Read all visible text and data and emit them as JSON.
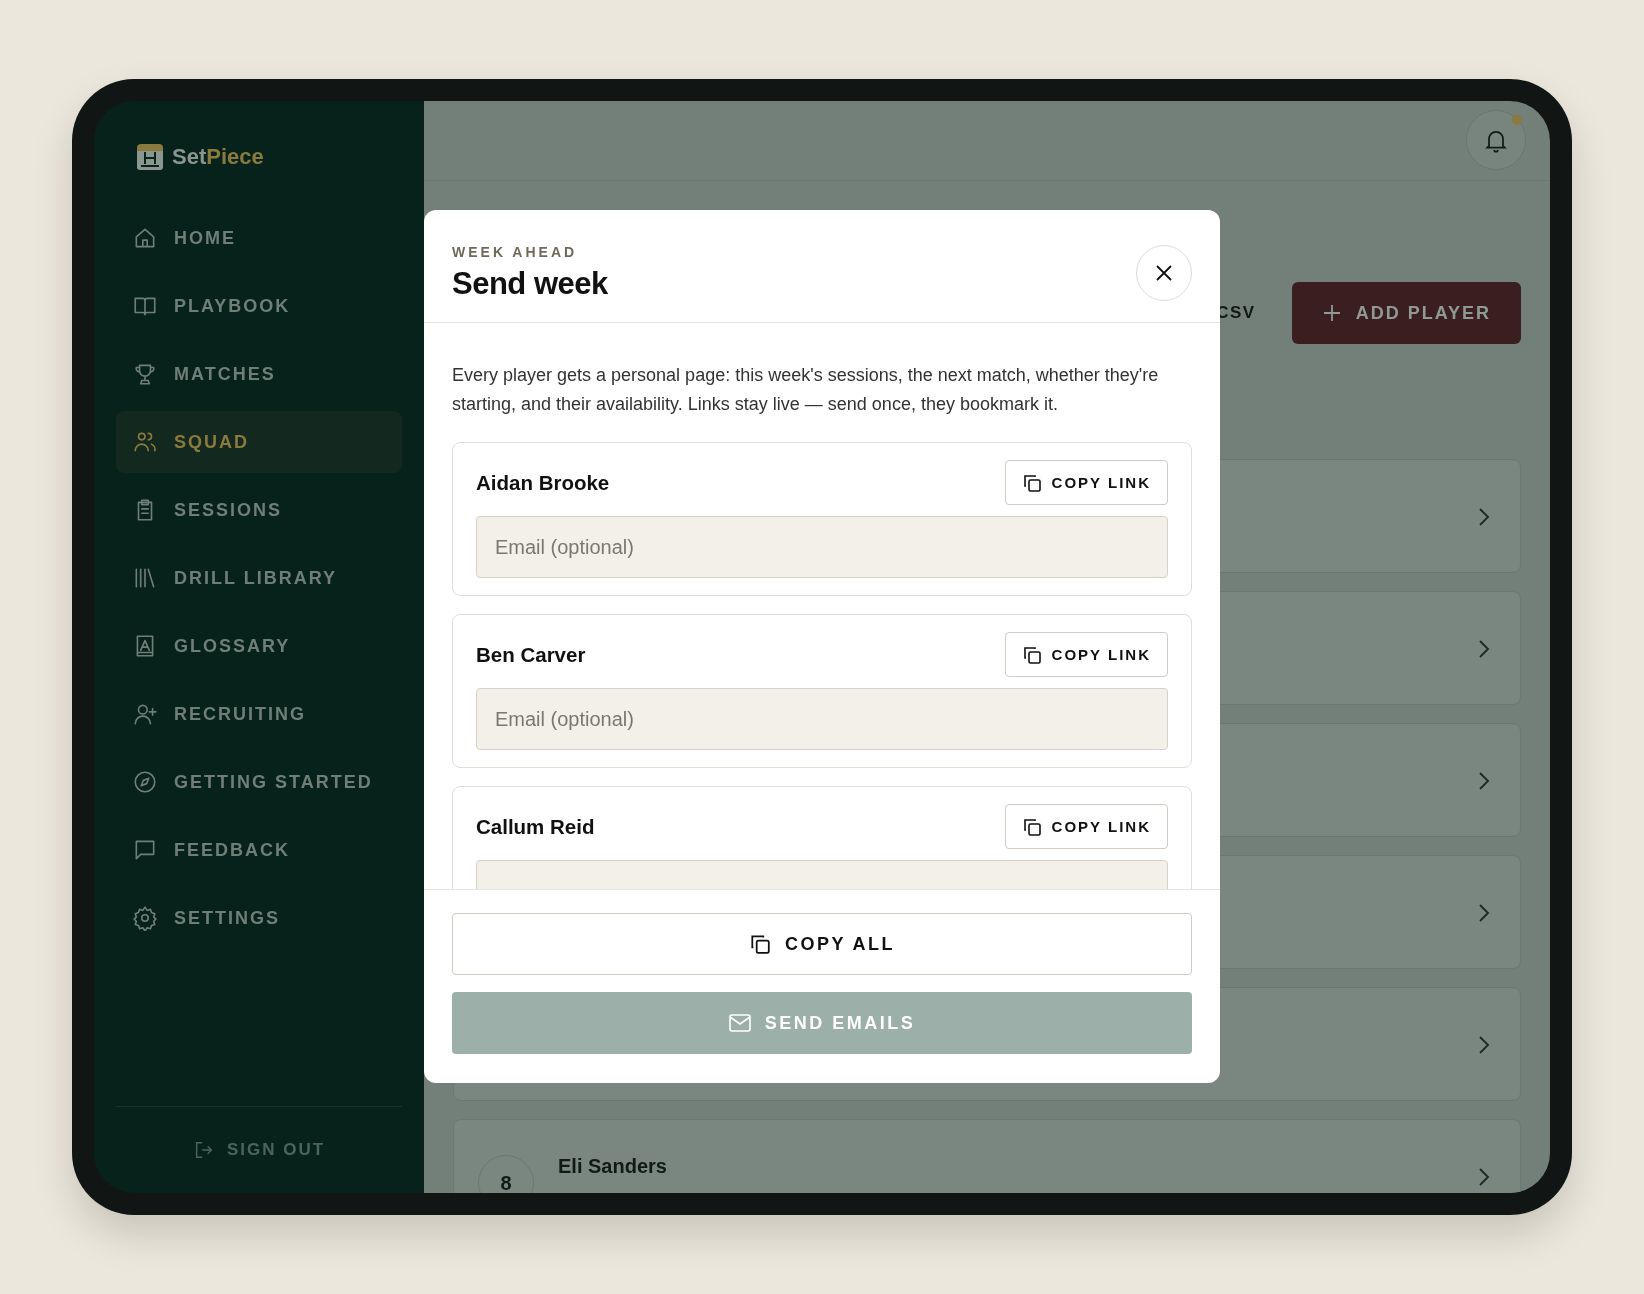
{
  "sidebar": {
    "brand": [
      "Set",
      "Piece"
    ],
    "items": [
      {
        "label": "HOME",
        "selected": false
      },
      {
        "label": "PLAYBOOK",
        "selected": false
      },
      {
        "label": "MATCHES",
        "selected": false
      },
      {
        "label": "SQUAD",
        "selected": true
      },
      {
        "label": "SESSIONS",
        "selected": false
      },
      {
        "label": "DRILL LIBRARY",
        "selected": false
      },
      {
        "label": "GLOSSARY",
        "selected": false
      },
      {
        "label": "RECRUITING",
        "selected": false
      },
      {
        "label": "GETTING STARTED",
        "selected": false
      },
      {
        "label": "FEEDBACK",
        "selected": false
      },
      {
        "label": "SETTINGS",
        "selected": false
      }
    ],
    "sign_out": "SIGN OUT"
  },
  "topbar": {
    "notification_dot": true
  },
  "actions": {
    "csv_button": "CSV",
    "add_button": "ADD PLAYER"
  },
  "squad_rows": [
    {
      "kind": "covered"
    },
    {
      "kind": "covered"
    },
    {
      "kind": "covered"
    },
    {
      "kind": "covered"
    },
    {
      "kind": "covered"
    },
    {
      "kind": "player",
      "number": "8",
      "name": "Eli Sanders"
    }
  ],
  "modal": {
    "eyebrow": "WEEK AHEAD",
    "title": "Send week",
    "description": "Every player gets a personal page: this week's sessions, the next match, whether they're starting, and their availability. Links stay live — send once, they bookmark it.",
    "players": [
      {
        "name": "Aidan Brooke",
        "copy_label": "COPY LINK",
        "email_placeholder": "Email (optional)"
      },
      {
        "name": "Ben Carver",
        "copy_label": "COPY LINK",
        "email_placeholder": "Email (optional)"
      },
      {
        "name": "Callum Reid",
        "copy_label": "COPY LINK"
      }
    ],
    "copy_all": "COPY ALL",
    "send": {
      "label": "SEND EMAILS",
      "disabled": true
    }
  }
}
